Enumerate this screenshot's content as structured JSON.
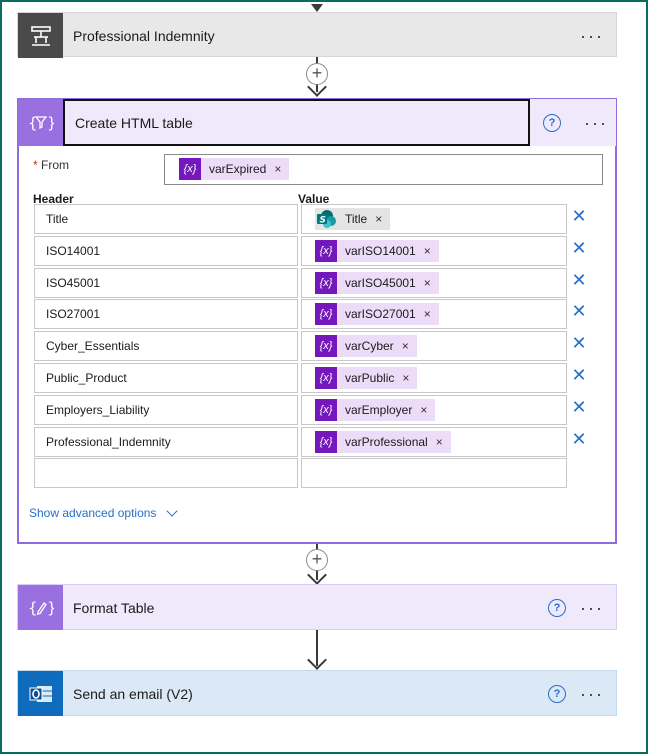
{
  "steps": {
    "professional_indemnity": {
      "title": "Professional Indemnity",
      "icon": "table-split-icon"
    },
    "create_html_table": {
      "title": "Create HTML table",
      "icon": "data-operation-icon",
      "from_label": "From",
      "from_required_mark": "*",
      "from_token": "varExpired",
      "header_col": "Header",
      "value_col": "Value",
      "rows": [
        {
          "header": "Title",
          "value": "Title",
          "token_kind": "sharepoint"
        },
        {
          "header": "ISO14001",
          "value": "varISO14001",
          "token_kind": "variable"
        },
        {
          "header": "ISO45001",
          "value": "varISO45001",
          "token_kind": "variable"
        },
        {
          "header": "ISO27001",
          "value": "varISO27001",
          "token_kind": "variable"
        },
        {
          "header": "Cyber_Essentials",
          "value": "varCyber",
          "token_kind": "variable"
        },
        {
          "header": "Public_Product",
          "value": "varPublic",
          "token_kind": "variable"
        },
        {
          "header": "Employers_Liability",
          "value": "varEmployer",
          "token_kind": "variable"
        },
        {
          "header": "Professional_Indemnity",
          "value": "varProfessional",
          "token_kind": "variable"
        },
        {
          "header": "",
          "value": "",
          "token_kind": "none"
        }
      ],
      "advanced_link": "Show advanced options"
    },
    "format_table": {
      "title": "Format Table",
      "icon": "compose-icon"
    },
    "send_email": {
      "title": "Send an email (V2)",
      "icon": "outlook-icon"
    }
  },
  "glyphs": {
    "more": "···",
    "help": "?",
    "remove": "×",
    "delete_row": "✕",
    "add": "+",
    "variable": "{x}"
  },
  "colors": {
    "accent_purple": "#7418bd",
    "data_op_icon": "#9a6fe0",
    "data_op_bg": "#efe9fb",
    "outlook_blue": "#0f6cbd",
    "email_bg": "#dbe9f6",
    "link_blue": "#2a6ec6",
    "frame_green": "#0c6b5c"
  }
}
